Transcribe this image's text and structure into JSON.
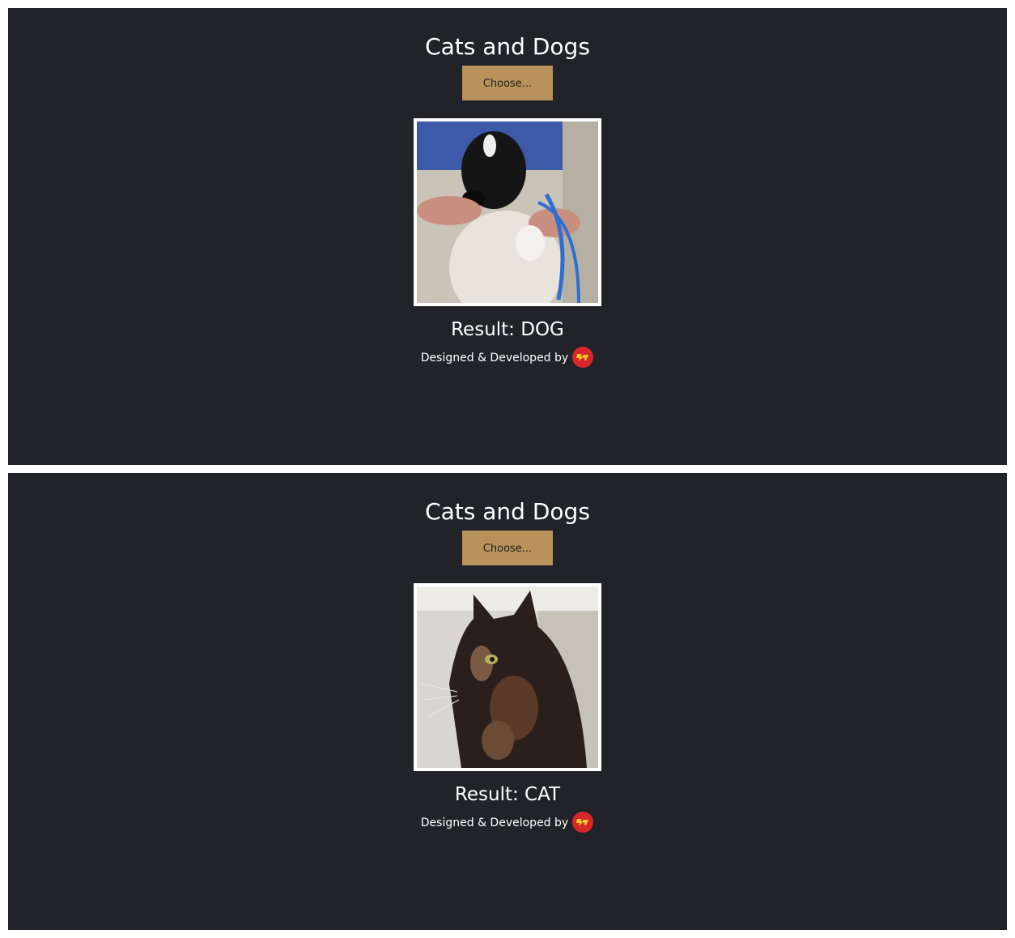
{
  "panels": [
    {
      "title": "Cats and Dogs",
      "choose_label": "Choose...",
      "image_subject": "dog",
      "result": "Result: DOG",
      "credit": "Designed & Developed by"
    },
    {
      "title": "Cats and Dogs",
      "choose_label": "Choose...",
      "image_subject": "cat",
      "result": "Result: CAT",
      "credit": "Designed & Developed by"
    }
  ],
  "colors": {
    "background": "#212329",
    "button": "#b8925a",
    "logo_red": "#d8262a",
    "logo_yellow": "#f5d020"
  }
}
